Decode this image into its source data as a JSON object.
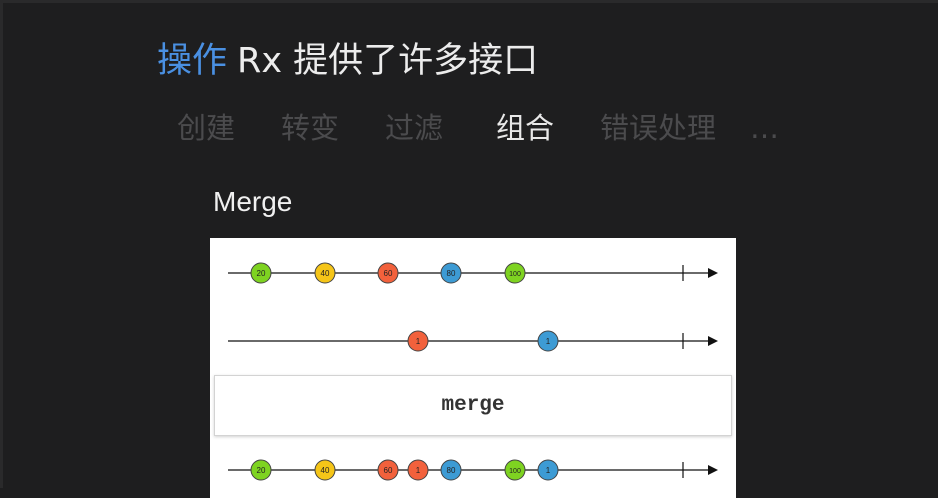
{
  "header": {
    "title_highlight": "操作",
    "title_rest": "Rx 提供了许多接口"
  },
  "tabs": [
    {
      "label": "创建",
      "active": false
    },
    {
      "label": "转变",
      "active": false
    },
    {
      "label": "过滤",
      "active": false
    },
    {
      "label": "组合",
      "active": true
    },
    {
      "label": "错误处理",
      "active": false
    },
    {
      "label": "…",
      "active": false
    }
  ],
  "section": {
    "title": "Merge"
  },
  "diagram": {
    "operator_label": "merge",
    "colors": {
      "green": "#7ed321",
      "yellow": "#f5c518",
      "red": "#f2613c",
      "blue": "#3d9bd4",
      "line": "#111111"
    },
    "marble_order": {
      "source_a": [
        {
          "label": "20",
          "color": "green"
        },
        {
          "label": "40",
          "color": "yellow"
        },
        {
          "label": "60",
          "color": "red"
        },
        {
          "label": "80",
          "color": "blue"
        },
        {
          "label": "100",
          "color": "green"
        }
      ],
      "source_b": [
        {
          "label": "1",
          "color": "red"
        },
        {
          "label": "1",
          "color": "blue"
        }
      ],
      "output": [
        {
          "label": "20",
          "color": "green"
        },
        {
          "label": "40",
          "color": "yellow"
        },
        {
          "label": "60",
          "color": "red"
        },
        {
          "label": "1",
          "color": "red"
        },
        {
          "label": "80",
          "color": "blue"
        },
        {
          "label": "100",
          "color": "green"
        },
        {
          "label": "1",
          "color": "blue"
        }
      ]
    }
  }
}
